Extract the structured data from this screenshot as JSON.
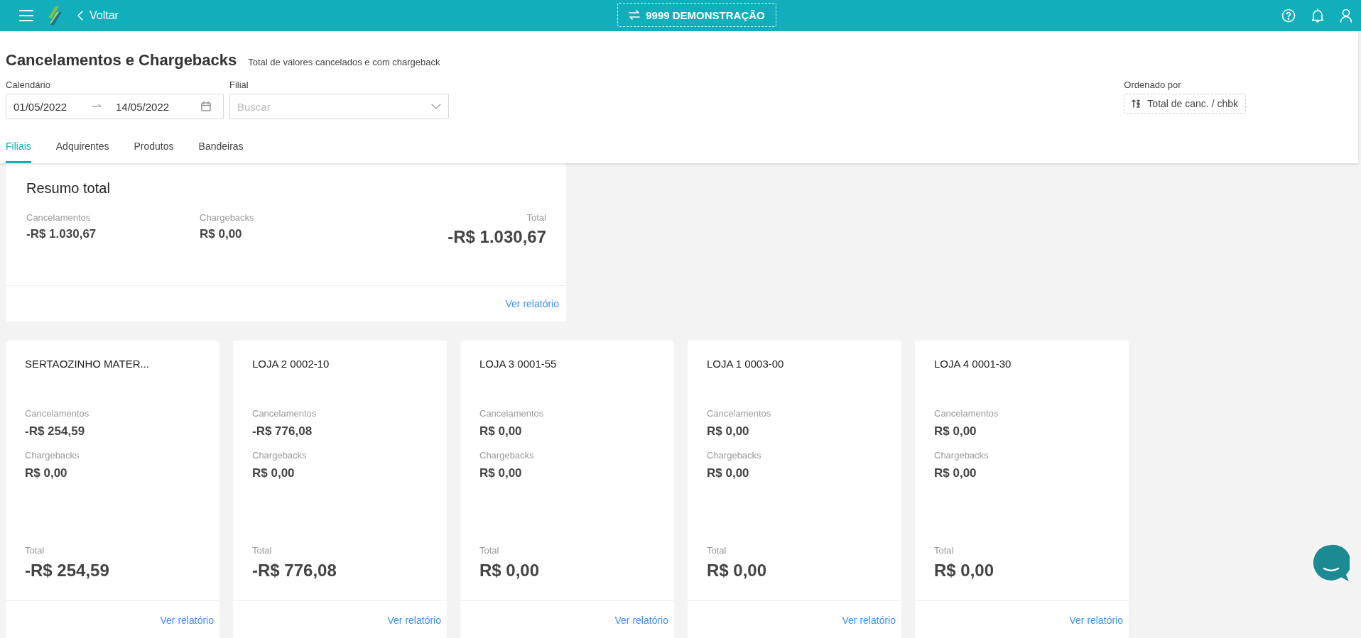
{
  "top_bar": {
    "back_label": "Voltar",
    "company_button": "9999 DEMONSTRAÇÃO"
  },
  "header": {
    "title": "Cancelamentos e Chargebacks",
    "subtitle": "Total de valores cancelados e com chargeback",
    "calendar": {
      "label": "Calendário",
      "start": "01/05/2022",
      "end": "14/05/2022"
    },
    "branch": {
      "label": "Filial",
      "placeholder": "Buscar"
    },
    "sort": {
      "label": "Ordenado por",
      "value": "Total de canc. / chbk"
    }
  },
  "tabs": [
    {
      "label": "Filiais",
      "selected": true
    },
    {
      "label": "Adquirentes",
      "selected": false
    },
    {
      "label": "Produtos",
      "selected": false
    },
    {
      "label": "Bandeiras",
      "selected": false
    }
  ],
  "summary": {
    "title": "Resumo total",
    "cancellations_label": "Cancelamentos",
    "cancellations": "-R$ 1.030,67",
    "chargebacks_label": "Chargebacks",
    "chargebacks": "R$ 0,00",
    "total_label": "Total",
    "total": "-R$ 1.030,67",
    "link": "Ver relatório"
  },
  "stores": [
    {
      "name": "SERTAOZINHO MATER...",
      "cancellations_label": "Cancelamentos",
      "cancellations": "-R$ 254,59",
      "chargebacks_label": "Chargebacks",
      "chargebacks": "R$ 0,00",
      "total_label": "Total",
      "total": "-R$ 254,59",
      "link": "Ver relatório"
    },
    {
      "name": "LOJA 2 0002-10",
      "cancellations_label": "Cancelamentos",
      "cancellations": "-R$ 776,08",
      "chargebacks_label": "Chargebacks",
      "chargebacks": "R$ 0,00",
      "total_label": "Total",
      "total": "-R$ 776,08",
      "link": "Ver relatório"
    },
    {
      "name": "LOJA 3 0001-55",
      "cancellations_label": "Cancelamentos",
      "cancellations": "R$ 0,00",
      "chargebacks_label": "Chargebacks",
      "chargebacks": "R$ 0,00",
      "total_label": "Total",
      "total": "R$ 0,00",
      "link": "Ver relatório"
    },
    {
      "name": "LOJA 1 0003-00",
      "cancellations_label": "Cancelamentos",
      "cancellations": "R$ 0,00",
      "chargebacks_label": "Chargebacks",
      "chargebacks": "R$ 0,00",
      "total_label": "Total",
      "total": "R$ 0,00",
      "link": "Ver relatório"
    },
    {
      "name": "LOJA 4 0001-30",
      "cancellations_label": "Cancelamentos",
      "cancellations": "R$ 0,00",
      "chargebacks_label": "Chargebacks",
      "chargebacks": "R$ 0,00",
      "total_label": "Total",
      "total": "R$ 0,00",
      "link": "Ver relatório"
    }
  ]
}
